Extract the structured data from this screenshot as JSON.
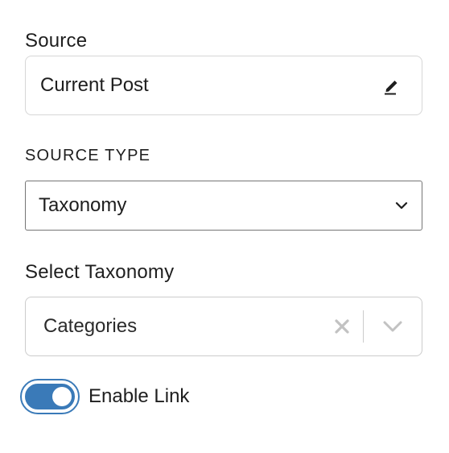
{
  "source": {
    "label": "Source",
    "value": "Current Post",
    "edit_icon": "pencil-icon"
  },
  "source_type": {
    "label": "SOURCE TYPE",
    "selected": "Taxonomy",
    "chevron_icon": "chevron-down-icon"
  },
  "taxonomy": {
    "label": "Select Taxonomy",
    "selected": "Categories",
    "clear_icon": "close-icon",
    "chevron_icon": "chevron-down-icon"
  },
  "link_toggle": {
    "label": "Enable Link",
    "checked": true
  },
  "colors": {
    "accent": "#3a7ab8",
    "text": "#1e1e1e",
    "border_light": "#d6d6d6",
    "border_select": "#757575",
    "icon_muted": "#c2c2c2"
  }
}
